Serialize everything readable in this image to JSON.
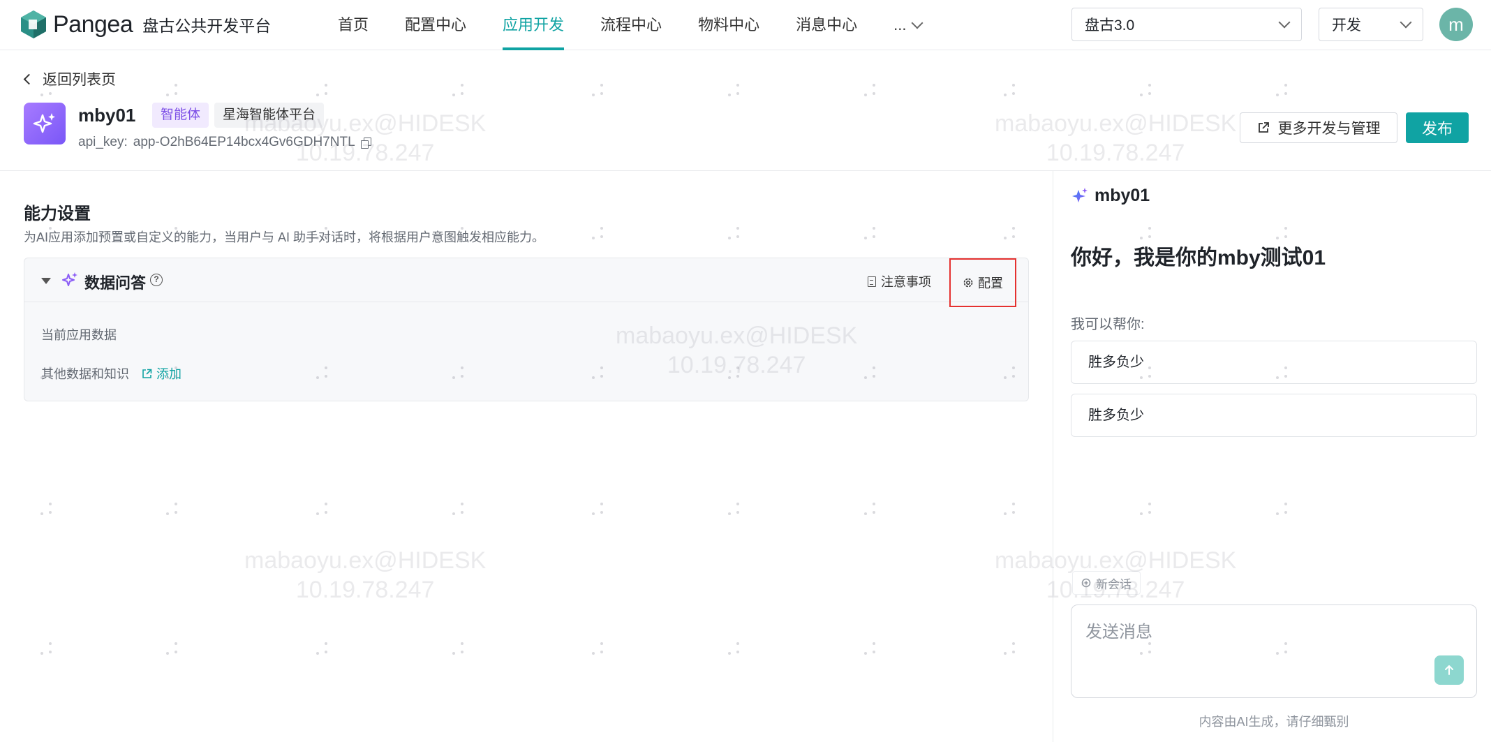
{
  "header": {
    "logo_text": "Pangea",
    "platform_name": "盘古公共开发平台",
    "nav": [
      {
        "label": "首页",
        "active": false
      },
      {
        "label": "配置中心",
        "active": false
      },
      {
        "label": "应用开发",
        "active": true
      },
      {
        "label": "流程中心",
        "active": false
      },
      {
        "label": "物料中心",
        "active": false
      },
      {
        "label": "消息中心",
        "active": false
      }
    ],
    "nav_more": "...",
    "version_select": "盘古3.0",
    "env_select": "开发",
    "avatar_letter": "m"
  },
  "app": {
    "back_label": "返回列表页",
    "name": "mby01",
    "tag_type": "智能体",
    "tag_platform": "星海智能体平台",
    "api_key_label": "api_key:",
    "api_key_value": "app-O2hB64EP14bcx4Gv6GDH7NTL",
    "more_button": "更多开发与管理",
    "publish_button": "发布"
  },
  "capability": {
    "title": "能力设置",
    "description": "为AI应用添加预置或自定义的能力，当用户与 AI 助手对话时，将根据用户意图触发相应能力。",
    "card": {
      "title": "数据问答",
      "notice_label": "注意事项",
      "config_label": "配置",
      "row_current": "当前应用数据",
      "row_other": "其他数据和知识",
      "add_label": "添加"
    }
  },
  "chat": {
    "bot_name": "mby01",
    "greeting": "你好，我是你的mby测试01",
    "help_label": "我可以帮你:",
    "suggestions": [
      "胜多负少",
      "胜多负少"
    ],
    "new_chat_label": "新会话",
    "input_placeholder": "发送消息",
    "disclaimer": "内容由AI生成，请仔细甄别"
  },
  "watermark": {
    "line1": "mabaoyu.ex@HIDESK",
    "line2": "10.19.78.247"
  },
  "colors": {
    "accent": "#10a3a3",
    "highlight_border": "#e5312f",
    "app_icon": "#8b5cf6"
  }
}
